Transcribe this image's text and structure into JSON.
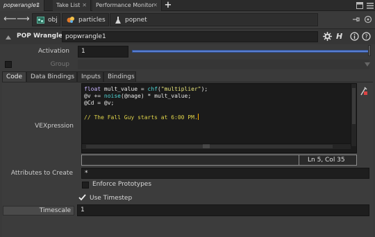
{
  "tabs": [
    {
      "label": "popwrangle1"
    },
    {
      "label": "Take List"
    },
    {
      "label": "Performance Monitor"
    }
  ],
  "nav": {
    "crumbs": [
      "obj",
      "particles",
      "popnet"
    ]
  },
  "header": {
    "node_type": "POP Wrangle",
    "node_name": "popwrangle1",
    "help_letter": "H"
  },
  "params": {
    "activation": {
      "label": "Activation",
      "value": "1",
      "fraction": 1.0
    },
    "group": {
      "label": "Group",
      "value": ""
    },
    "tabs": [
      "Code",
      "Data Bindings",
      "Inputs",
      "Bindings"
    ],
    "vexpression_label": "VEXpression",
    "code": {
      "line1_kw": "float",
      "line1_rest": " mult_value = ",
      "line1_fn": "chf",
      "line1_str": "\"multiplier\"",
      "line1_end": ");",
      "line2_a": "@v += ",
      "line2_fn": "noise",
      "line2_b": "(@nage) * mult_value;",
      "line3": "@Cd = @v;",
      "line5_comment": "// The Fall Guy starts at 6:00 PM."
    },
    "status_pos": "Ln 5, Col 35",
    "attributes_label": "Attributes to Create",
    "attributes_value": "*",
    "enforce_label": "Enforce Prototypes",
    "use_timestep_label": "Use Timestep",
    "timescale_label": "Timescale",
    "timescale_value": "1"
  },
  "colors": {
    "accent": "#5a7fd0",
    "keyword": "#c8b4ff",
    "function": "#4fd7d7",
    "string": "#e7e47a"
  }
}
